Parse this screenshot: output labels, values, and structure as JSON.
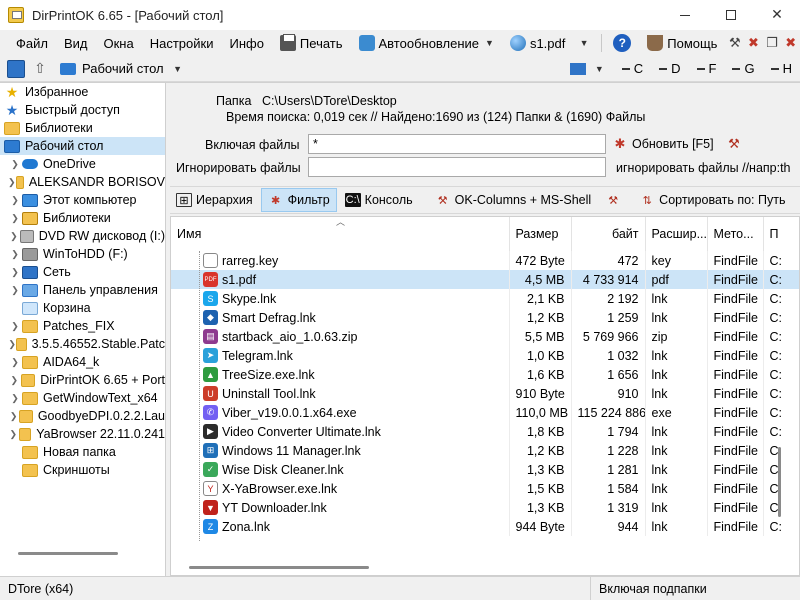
{
  "title": "DirPrintOK 6.65 - [Рабочий стол]",
  "menu": {
    "file": "Файл",
    "view": "Вид",
    "windows": "Окна",
    "settings": "Настройки",
    "info": "Инфо",
    "print": "Печать",
    "autoupdate": "Автообновление",
    "doc": "s1.pdf",
    "help": "Помощь"
  },
  "toolbar": {
    "path": "Рабочий стол",
    "letters": [
      "C",
      "D",
      "F",
      "G",
      "H"
    ]
  },
  "tree": [
    {
      "label": "Избранное",
      "icon": "star-icon",
      "caret": false,
      "selected": false
    },
    {
      "label": "Быстрый доступ",
      "icon": "quick-access-icon",
      "caret": false,
      "selected": false
    },
    {
      "label": "Библиотеки",
      "icon": "folder-icon",
      "caret": false,
      "selected": false
    },
    {
      "label": "Рабочий стол",
      "icon": "desktop-folder-icon",
      "caret": false,
      "selected": true
    },
    {
      "label": "OneDrive",
      "icon": "cloud-icon",
      "caret": true,
      "selected": false
    },
    {
      "label": "ALEKSANDR BORISOV",
      "icon": "folder-icon",
      "caret": true,
      "selected": false
    },
    {
      "label": "Этот компьютер",
      "icon": "computer-icon",
      "caret": true,
      "selected": false
    },
    {
      "label": "Библиотеки",
      "icon": "library-icon",
      "caret": true,
      "selected": false
    },
    {
      "label": "DVD RW дисковод (I:)",
      "icon": "dvd-icon",
      "caret": true,
      "selected": false
    },
    {
      "label": "WinToHDD (F:)",
      "icon": "usb-drive-icon",
      "caret": true,
      "selected": false
    },
    {
      "label": "Сеть",
      "icon": "network-icon",
      "caret": true,
      "selected": false
    },
    {
      "label": "Панель управления",
      "icon": "control-panel-icon",
      "caret": true,
      "selected": false
    },
    {
      "label": "Корзина",
      "icon": "recycle-bin-icon",
      "caret": false,
      "selected": false
    },
    {
      "label": "Patches_FIX",
      "icon": "folder-icon",
      "caret": true,
      "selected": false
    },
    {
      "label": "3.5.5.46552.Stable.Patc",
      "icon": "folder-icon",
      "caret": true,
      "selected": false
    },
    {
      "label": "AIDA64_k",
      "icon": "folder-icon",
      "caret": true,
      "selected": false
    },
    {
      "label": "DirPrintOK 6.65 + Port",
      "icon": "folder-icon",
      "caret": true,
      "selected": false
    },
    {
      "label": "GetWindowText_x64",
      "icon": "folder-icon",
      "caret": true,
      "selected": false
    },
    {
      "label": "GoodbyeDPI.0.2.2.Lau",
      "icon": "folder-icon",
      "caret": true,
      "selected": false
    },
    {
      "label": "YaBrowser 22.11.0.241",
      "icon": "folder-icon",
      "caret": true,
      "selected": false
    },
    {
      "label": "Новая папка",
      "icon": "folder-icon",
      "caret": false,
      "selected": false
    },
    {
      "label": "Скриншоты",
      "icon": "folder-icon",
      "caret": false,
      "selected": false
    }
  ],
  "info": {
    "folder_label": "Папка",
    "folder_value": "C:\\Users\\DTore\\Desktop",
    "search_line": "Время поиска: 0,019 сек //  Найдено:1690 из (124) Папки & (1690) Файлы"
  },
  "filters": {
    "include_label": "Включая файлы",
    "include_value": "*",
    "ignore_label": "Игнорировать файлы",
    "ignore_value": "",
    "refresh_label": "Обновить [F5]",
    "ignore_hint": "игнорировать файлы //напр:th"
  },
  "tabs": {
    "hierarchy": "Иерархия",
    "filter": "Фильтр",
    "console": "Консоль",
    "ok_columns": "OK-Columns + MS-Shell",
    "sort": "Сортировать по: Путь"
  },
  "table": {
    "headers": [
      "Имя",
      "Размер",
      "байт",
      "Расшир...",
      "Мето...",
      "П"
    ],
    "rows": [
      {
        "name": "rarreg.key",
        "size": "472 Byte",
        "bytes": "472",
        "ext": "key",
        "method": "FindFile",
        "p": "C:",
        "icon": "key-file-icon",
        "color": "#ffffff"
      },
      {
        "name": "s1.pdf",
        "size": "4,5 MB",
        "bytes": "4 733 914",
        "ext": "pdf",
        "method": "FindFile",
        "p": "C:",
        "icon": "pdf-icon",
        "color": "#d9342b"
      },
      {
        "name": "Skype.lnk",
        "size": "2,1 KB",
        "bytes": "2 192",
        "ext": "lnk",
        "method": "FindFile",
        "p": "C:",
        "icon": "skype-icon",
        "color": "#1aa7ec"
      },
      {
        "name": "Smart Defrag.lnk",
        "size": "1,2 KB",
        "bytes": "1 259",
        "ext": "lnk",
        "method": "FindFile",
        "p": "C:",
        "icon": "defrag-icon",
        "color": "#1d62b0"
      },
      {
        "name": "startback_aio_1.0.63.zip",
        "size": "5,5 MB",
        "bytes": "5 769 966",
        "ext": "zip",
        "method": "FindFile",
        "p": "C:",
        "icon": "zip-icon",
        "color": "#8e3a8f"
      },
      {
        "name": "Telegram.lnk",
        "size": "1,0 KB",
        "bytes": "1 032",
        "ext": "lnk",
        "method": "FindFile",
        "p": "C:",
        "icon": "telegram-icon",
        "color": "#2aa1da"
      },
      {
        "name": "TreeSize.exe.lnk",
        "size": "1,6 KB",
        "bytes": "1 656",
        "ext": "lnk",
        "method": "FindFile",
        "p": "C:",
        "icon": "treesize-icon",
        "color": "#2e9b3f"
      },
      {
        "name": "Uninstall Tool.lnk",
        "size": "910 Byte",
        "bytes": "910",
        "ext": "lnk",
        "method": "FindFile",
        "p": "C:",
        "icon": "uninstall-icon",
        "color": "#cc3d2a"
      },
      {
        "name": "Viber_v19.0.0.1.x64.exe",
        "size": "110,0 MB",
        "bytes": "115 224 886",
        "ext": "exe",
        "method": "FindFile",
        "p": "C:",
        "icon": "viber-icon",
        "color": "#7360f2"
      },
      {
        "name": "Video Converter Ultimate.lnk",
        "size": "1,8 KB",
        "bytes": "1 794",
        "ext": "lnk",
        "method": "FindFile",
        "p": "C:",
        "icon": "video-converter-icon",
        "color": "#2b2b2b"
      },
      {
        "name": "Windows 11 Manager.lnk",
        "size": "1,2 KB",
        "bytes": "1 228",
        "ext": "lnk",
        "method": "FindFile",
        "p": "C:",
        "icon": "windows-manager-icon",
        "color": "#1f6fb8"
      },
      {
        "name": "Wise Disk Cleaner.lnk",
        "size": "1,3 KB",
        "bytes": "1 281",
        "ext": "lnk",
        "method": "FindFile",
        "p": "C:",
        "icon": "wise-cleaner-icon",
        "color": "#3aa85a"
      },
      {
        "name": "X-YaBrowser.exe.lnk",
        "size": "1,5 KB",
        "bytes": "1 584",
        "ext": "lnk",
        "method": "FindFile",
        "p": "C:",
        "icon": "yandex-icon",
        "color": "#ffffff"
      },
      {
        "name": "YT Downloader.lnk",
        "size": "1,3 KB",
        "bytes": "1 319",
        "ext": "lnk",
        "method": "FindFile",
        "p": "C:",
        "icon": "yt-downloader-icon",
        "color": "#c0221b"
      },
      {
        "name": "Zona.lnk",
        "size": "944 Byte",
        "bytes": "944",
        "ext": "lnk",
        "method": "FindFile",
        "p": "C:",
        "icon": "zona-icon",
        "color": "#1e88e5"
      }
    ]
  },
  "status": {
    "left": "DTore (x64)",
    "right": "Включая подпапки"
  }
}
